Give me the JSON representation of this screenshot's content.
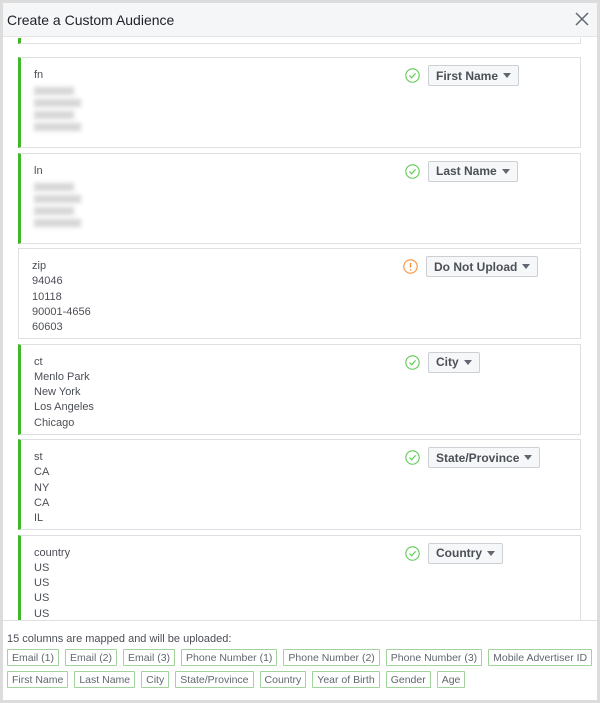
{
  "title": "Create a Custom Audience",
  "colors": {
    "mapped": "#42b72a",
    "warning": "#f7923b",
    "check": "#5fcb55"
  },
  "cards": [
    {
      "header": "fn",
      "values": [],
      "blurred_rows": 4,
      "status": "check-icon",
      "mapping": "First Name"
    },
    {
      "header": "ln",
      "values": [],
      "blurred_rows": 4,
      "status": "check-icon",
      "mapping": "Last Name"
    },
    {
      "header": "zip",
      "values": [
        "94046",
        "10118",
        "90001-4656",
        "60603"
      ],
      "status": "warning-icon",
      "mapping": "Do Not Upload"
    },
    {
      "header": "ct",
      "values": [
        "Menlo Park",
        "New York",
        "Los Angeles",
        "Chicago"
      ],
      "status": "check-icon",
      "mapping": "City"
    },
    {
      "header": "st",
      "values": [
        "CA",
        "NY",
        "CA",
        "IL"
      ],
      "status": "check-icon",
      "mapping": "State/Province"
    },
    {
      "header": "country",
      "values": [
        "US",
        "US",
        "US",
        "US"
      ],
      "status": "check-icon",
      "mapping": "Country"
    }
  ],
  "footer": {
    "summary": "15 columns are mapped and will be uploaded:",
    "tags": [
      "Email (1)",
      "Email (2)",
      "Email (3)",
      "Phone Number (1)",
      "Phone Number (2)",
      "Phone Number (3)",
      "Mobile Advertiser ID",
      "First Name",
      "Last Name",
      "City",
      "State/Province",
      "Country",
      "Year of Birth",
      "Gender",
      "Age"
    ]
  }
}
